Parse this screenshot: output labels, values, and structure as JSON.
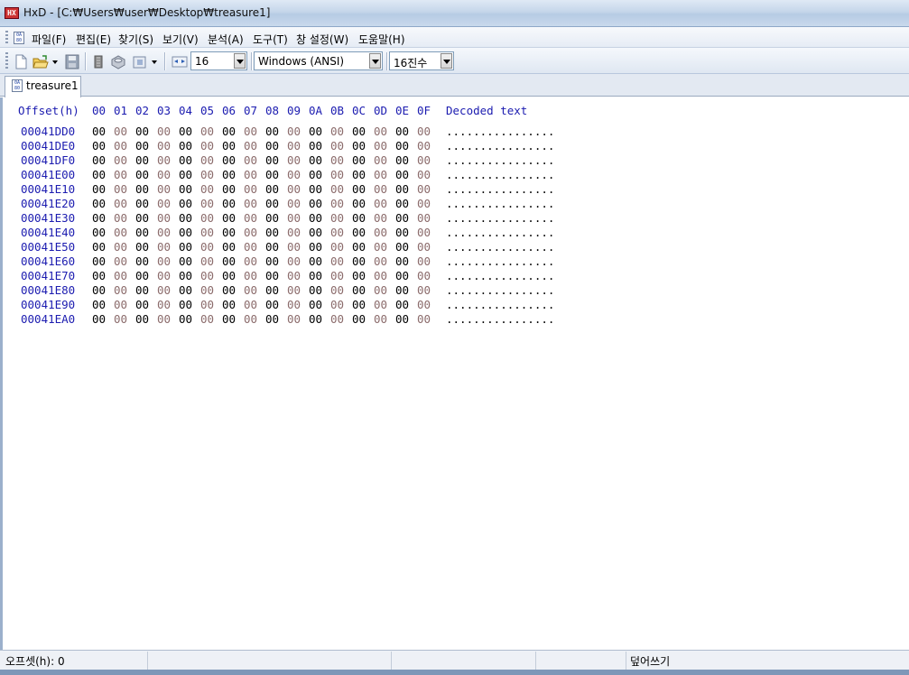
{
  "window": {
    "title": "HxD - [C:₩Users₩user₩Desktop₩treasure1]",
    "app_icon": "hxd-app-icon"
  },
  "menu": {
    "items": [
      "파일(F)",
      "편집(E)",
      "찾기(S)",
      "보기(V)",
      "분석(A)",
      "도구(T)",
      "창 설정(W)",
      "도움말(H)"
    ]
  },
  "toolbar": {
    "bytes_per_row": "16",
    "charset": "Windows (ANSI)",
    "number_base": "16진수"
  },
  "tab": {
    "label": "treasure1"
  },
  "hex": {
    "offset_header": "Offset(h)",
    "columns": [
      "00",
      "01",
      "02",
      "03",
      "04",
      "05",
      "06",
      "07",
      "08",
      "09",
      "0A",
      "0B",
      "0C",
      "0D",
      "0E",
      "0F"
    ],
    "decoded_header": "Decoded text",
    "rows": [
      {
        "offset": "00041DD0",
        "bytes": [
          "00",
          "00",
          "00",
          "00",
          "00",
          "00",
          "00",
          "00",
          "00",
          "00",
          "00",
          "00",
          "00",
          "00",
          "00",
          "00"
        ],
        "text": "................"
      },
      {
        "offset": "00041DE0",
        "bytes": [
          "00",
          "00",
          "00",
          "00",
          "00",
          "00",
          "00",
          "00",
          "00",
          "00",
          "00",
          "00",
          "00",
          "00",
          "00",
          "00"
        ],
        "text": "................"
      },
      {
        "offset": "00041DF0",
        "bytes": [
          "00",
          "00",
          "00",
          "00",
          "00",
          "00",
          "00",
          "00",
          "00",
          "00",
          "00",
          "00",
          "00",
          "00",
          "00",
          "00"
        ],
        "text": "................"
      },
      {
        "offset": "00041E00",
        "bytes": [
          "00",
          "00",
          "00",
          "00",
          "00",
          "00",
          "00",
          "00",
          "00",
          "00",
          "00",
          "00",
          "00",
          "00",
          "00",
          "00"
        ],
        "text": "................"
      },
      {
        "offset": "00041E10",
        "bytes": [
          "00",
          "00",
          "00",
          "00",
          "00",
          "00",
          "00",
          "00",
          "00",
          "00",
          "00",
          "00",
          "00",
          "00",
          "00",
          "00"
        ],
        "text": "................"
      },
      {
        "offset": "00041E20",
        "bytes": [
          "00",
          "00",
          "00",
          "00",
          "00",
          "00",
          "00",
          "00",
          "00",
          "00",
          "00",
          "00",
          "00",
          "00",
          "00",
          "00"
        ],
        "text": "................"
      },
      {
        "offset": "00041E30",
        "bytes": [
          "00",
          "00",
          "00",
          "00",
          "00",
          "00",
          "00",
          "00",
          "00",
          "00",
          "00",
          "00",
          "00",
          "00",
          "00",
          "00"
        ],
        "text": "................"
      },
      {
        "offset": "00041E40",
        "bytes": [
          "00",
          "00",
          "00",
          "00",
          "00",
          "00",
          "00",
          "00",
          "00",
          "00",
          "00",
          "00",
          "00",
          "00",
          "00",
          "00"
        ],
        "text": "................"
      },
      {
        "offset": "00041E50",
        "bytes": [
          "00",
          "00",
          "00",
          "00",
          "00",
          "00",
          "00",
          "00",
          "00",
          "00",
          "00",
          "00",
          "00",
          "00",
          "00",
          "00"
        ],
        "text": "................"
      },
      {
        "offset": "00041E60",
        "bytes": [
          "00",
          "00",
          "00",
          "00",
          "00",
          "00",
          "00",
          "00",
          "00",
          "00",
          "00",
          "00",
          "00",
          "00",
          "00",
          "00"
        ],
        "text": "................"
      },
      {
        "offset": "00041E70",
        "bytes": [
          "00",
          "00",
          "00",
          "00",
          "00",
          "00",
          "00",
          "00",
          "00",
          "00",
          "00",
          "00",
          "00",
          "00",
          "00",
          "00"
        ],
        "text": "................"
      },
      {
        "offset": "00041E80",
        "bytes": [
          "00",
          "00",
          "00",
          "00",
          "00",
          "00",
          "00",
          "00",
          "00",
          "00",
          "00",
          "00",
          "00",
          "00",
          "00",
          "00"
        ],
        "text": "................"
      },
      {
        "offset": "00041E90",
        "bytes": [
          "00",
          "00",
          "00",
          "00",
          "00",
          "00",
          "00",
          "00",
          "00",
          "00",
          "00",
          "00",
          "00",
          "00",
          "00",
          "00"
        ],
        "text": "................"
      },
      {
        "offset": "00041EA0",
        "bytes": [
          "00",
          "00",
          "00",
          "00",
          "00",
          "00",
          "00",
          "00",
          "00",
          "00",
          "00",
          "00",
          "00",
          "00",
          "00",
          "00"
        ],
        "text": "................"
      }
    ]
  },
  "status": {
    "offset": "오프셋(h): 0",
    "mode": "덮어쓰기"
  }
}
